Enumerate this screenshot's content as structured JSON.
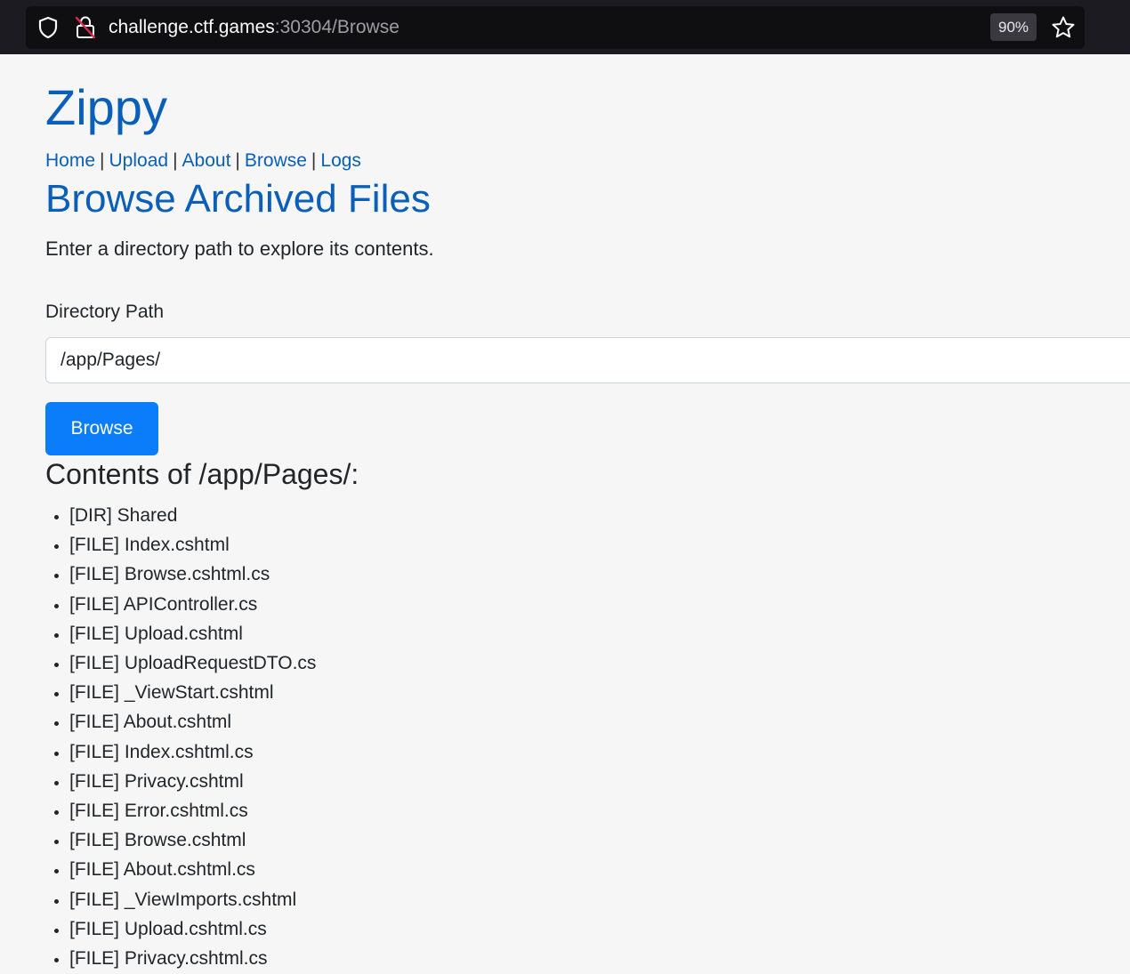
{
  "browser": {
    "url_host": "challenge.ctf.games",
    "url_port_path": ":30304/Browse",
    "zoom": "90%"
  },
  "site": {
    "title": "Zippy"
  },
  "nav": {
    "items": [
      "Home",
      "Upload",
      "About",
      "Browse",
      "Logs"
    ],
    "separator": "|"
  },
  "main": {
    "heading": "Browse Archived Files",
    "intro": "Enter a directory path to explore its contents.",
    "path_label": "Directory Path",
    "path_value": "/app/Pages/",
    "browse_button": "Browse",
    "contents_heading": "Contents of /app/Pages/:",
    "entries": [
      "[DIR] Shared",
      "[FILE] Index.cshtml",
      "[FILE] Browse.cshtml.cs",
      "[FILE] APIController.cs",
      "[FILE] Upload.cshtml",
      "[FILE] UploadRequestDTO.cs",
      "[FILE] _ViewStart.cshtml",
      "[FILE] About.cshtml",
      "[FILE] Index.cshtml.cs",
      "[FILE] Privacy.cshtml",
      "[FILE] Error.cshtml.cs",
      "[FILE] Browse.cshtml",
      "[FILE] About.cshtml.cs",
      "[FILE] _ViewImports.cshtml",
      "[FILE] Upload.cshtml.cs",
      "[FILE] Privacy.cshtml.cs"
    ]
  },
  "colors": {
    "link": "#0a5fb8",
    "button": "#0b7dfb",
    "background": "#f6f6f6"
  }
}
